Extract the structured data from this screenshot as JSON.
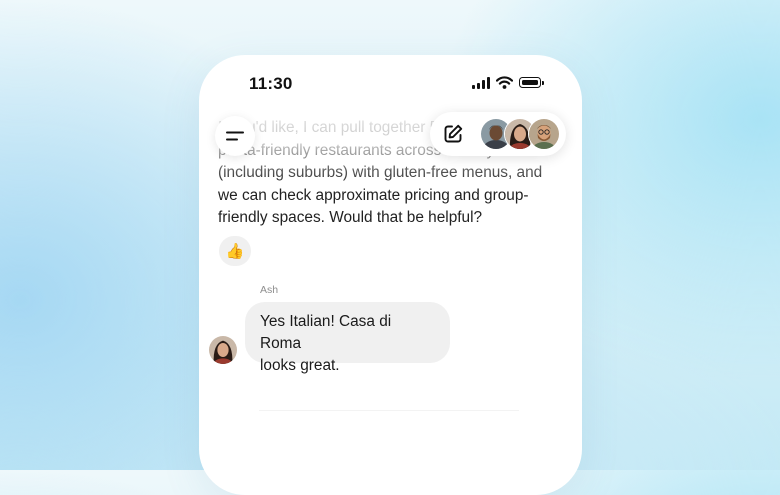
{
  "status_bar": {
    "time": "11:30",
    "icons": [
      "signal-icon",
      "wifi-icon",
      "battery-icon"
    ]
  },
  "header": {
    "menu_icon": "menu-icon",
    "compose_icon": "compose-icon",
    "participants": [
      "avatar-man-dark-hair",
      "avatar-woman-long-hair",
      "avatar-man-glasses-beard"
    ]
  },
  "conversation": {
    "assistant_message": {
      "lines": [
        "If you'd like, I can pull together 5",
        "pasta-friendly restaurants across the city",
        "(including suburbs) with gluten-free menus, and",
        "we can check approximate pricing and group-",
        "friendly spaces. Would that be helpful?"
      ],
      "reaction": "👍"
    },
    "user_message": {
      "sender": "Ash",
      "lines": [
        "Yes Italian! Casa di Roma",
        "looks great."
      ]
    }
  },
  "colors": {
    "accent_bg": "#c3e9f5",
    "bubble_bg": "#f0f0f0",
    "text": "#222222",
    "muted": "#8e8e8e"
  }
}
